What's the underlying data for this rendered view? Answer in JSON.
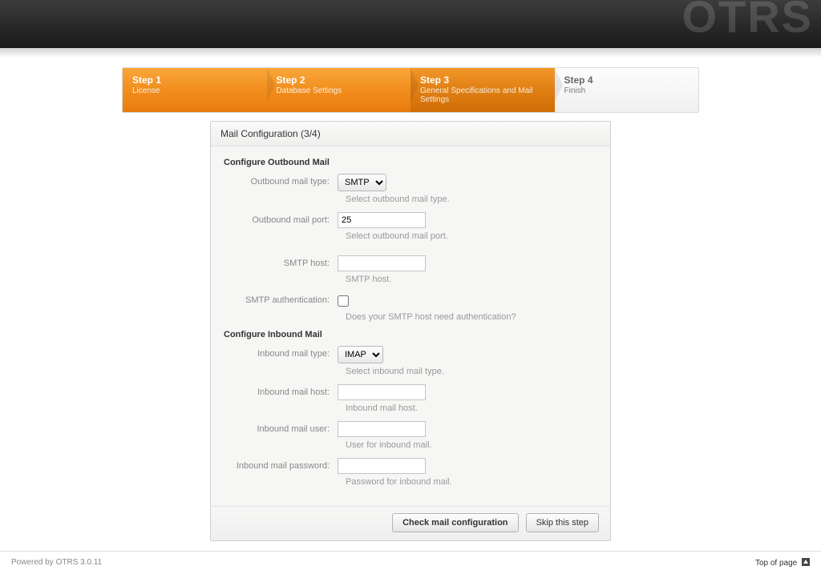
{
  "logo_text": "OTRS",
  "steps": [
    {
      "title": "Step 1",
      "sub": "License"
    },
    {
      "title": "Step 2",
      "sub": "Database Settings"
    },
    {
      "title": "Step 3",
      "sub": "General Specifications and Mail Settings"
    },
    {
      "title": "Step 4",
      "sub": "Finish"
    }
  ],
  "panel": {
    "header": "Mail Configuration (3/4)",
    "outbound_section": "Configure Outbound Mail",
    "inbound_section": "Configure Inbound Mail",
    "fields": {
      "outbound_type": {
        "label": "Outbound mail type:",
        "value": "SMTP",
        "hint": "Select outbound mail type."
      },
      "outbound_port": {
        "label": "Outbound mail port:",
        "value": "25",
        "hint": "Select outbound mail port."
      },
      "smtp_host": {
        "label": "SMTP host:",
        "value": "",
        "hint": "SMTP host."
      },
      "smtp_auth": {
        "label": "SMTP authentication:",
        "checked": false,
        "hint": "Does your SMTP host need authentication?"
      },
      "inbound_type": {
        "label": "Inbound mail type:",
        "value": "IMAP",
        "hint": "Select inbound mail type."
      },
      "inbound_host": {
        "label": "Inbound mail host:",
        "value": "",
        "hint": "Inbound mail host."
      },
      "inbound_user": {
        "label": "Inbound mail user:",
        "value": "",
        "hint": "User for inbound mail."
      },
      "inbound_pass": {
        "label": "Inbound mail password:",
        "value": "",
        "hint": "Password for inbound mail."
      }
    },
    "actions": {
      "check": "Check mail configuration",
      "skip": "Skip this step"
    }
  },
  "footer": {
    "powered": "Powered by OTRS 3.0.11",
    "top": "Top of page"
  }
}
